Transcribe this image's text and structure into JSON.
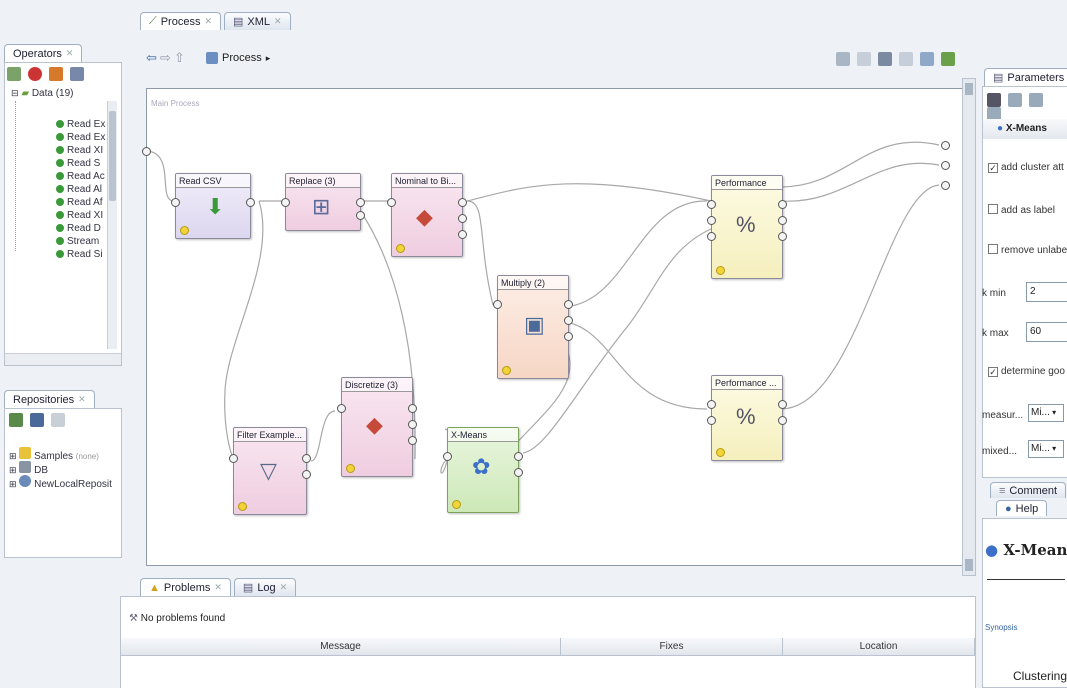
{
  "tabs": {
    "process": "Process",
    "xml": "XML",
    "operators": "Operators",
    "repositories": "Repositories",
    "problems": "Problems",
    "log": "Log",
    "parameters": "Parameters",
    "comment": "Comment",
    "help": "Help"
  },
  "toolbar": {
    "breadcrumb": "Process"
  },
  "operators_tree": {
    "group_label": "Data (19)",
    "items": [
      "Read Ex",
      "Read Ex",
      "Read XI",
      "Read S",
      "Read Ac",
      "Read Al",
      "Read Af",
      "Read XI",
      "Read D",
      "Stream",
      "Read Si"
    ]
  },
  "repositories_tree": {
    "items": [
      {
        "label": "Samples",
        "note": "(none)"
      },
      {
        "label": "DB",
        "note": ""
      },
      {
        "label": "NewLocalReposit",
        "note": ""
      }
    ]
  },
  "canvas": {
    "title": "Main Process",
    "operators": {
      "read_csv": "Read CSV",
      "replace": "Replace (3)",
      "nominal": "Nominal to Bi...",
      "multiply": "Multiply (2)",
      "performance1": "Performance",
      "performance2": "Performance ...",
      "filter": "Filter Example...",
      "discretize": "Discretize (3)",
      "xmeans": "X-Means"
    }
  },
  "parameters": {
    "operator_title": "X-Means",
    "add_cluster_attribute": "add cluster att",
    "add_as_label": "add as label",
    "remove_unlabeled": "remove unlabe",
    "k_min_label": "k min",
    "k_min_value": "2",
    "k_max_label": "k max",
    "k_max_value": "60",
    "determine_good": "determine goo",
    "measure_label": "measur...",
    "measure_value": "Mi...",
    "mixed_label": "mixed...",
    "mixed_value": "Mi..."
  },
  "help": {
    "title": "X-Means",
    "synopsis": "Synopsis",
    "category": "Clustering"
  },
  "problems": {
    "status": "No problems found",
    "columns": [
      "Message",
      "Fixes",
      "Location"
    ]
  }
}
